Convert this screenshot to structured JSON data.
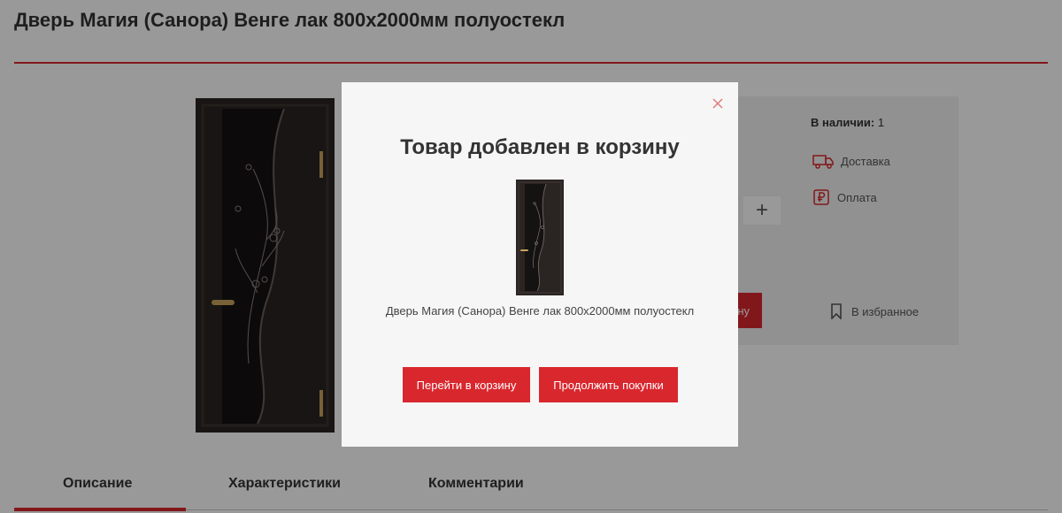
{
  "product": {
    "title": "Дверь Магия (Санора) Венге лак 800х2000мм полуостекл"
  },
  "info": {
    "stock_label": "В наличии:",
    "stock_value": " 1",
    "delivery_label": "Доставка",
    "payment_label": "Оплата",
    "qty_plus": "+",
    "buy_label_visible": "ну",
    "favorite_label": "В избранное"
  },
  "tabs": [
    {
      "label": "Описание"
    },
    {
      "label": "Характеристики"
    },
    {
      "label": "Комментарии"
    }
  ],
  "modal": {
    "title": "Товар добавлен в корзину",
    "product_name": "Дверь Магия (Санора) Венге лак 800х2000мм полуостекл",
    "go_to_cart": "Перейти в корзину",
    "continue_shopping": "Продолжить покупки"
  },
  "colors": {
    "accent": "#d9272e",
    "door": "#2a2422"
  },
  "icons": [
    "close-icon",
    "truck-icon",
    "ruble-icon",
    "bookmark-icon"
  ]
}
